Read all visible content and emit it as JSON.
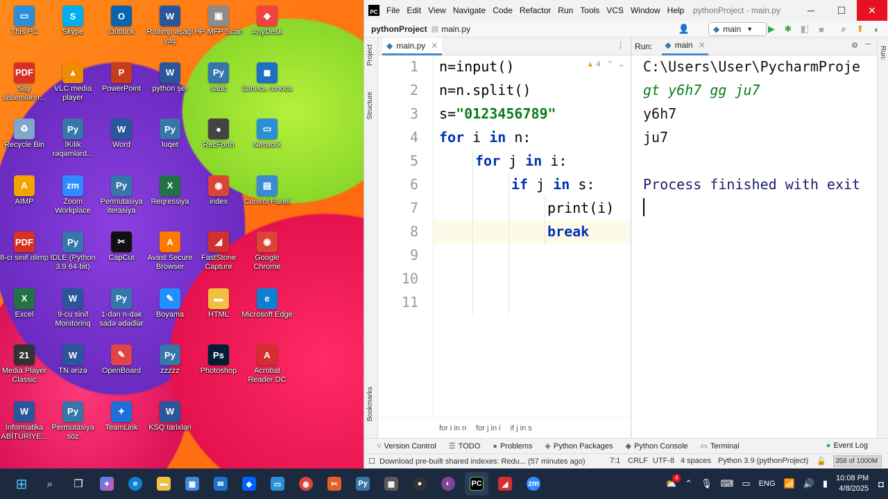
{
  "desktop": {
    "icons": [
      {
        "label": "This PC",
        "glyph": "▭",
        "color": "#2b8fd6"
      },
      {
        "label": "Skype",
        "glyph": "S",
        "color": "#00aff0"
      },
      {
        "label": "Outlook",
        "glyph": "O",
        "color": "#0a64ad"
      },
      {
        "label": "R olimp aşağı yaş",
        "glyph": "W",
        "color": "#2b579a"
      },
      {
        "label": "HP MFP Scan",
        "glyph": "▣",
        "color": "#8c8c8c"
      },
      {
        "label": "AnyDesk",
        "glyph": "◆",
        "color": "#ef443b"
      },
      {
        "label": "Say sistemlərin...",
        "glyph": "PDF",
        "color": "#d93025"
      },
      {
        "label": "VLC media player",
        "glyph": "▲",
        "color": "#f08a00"
      },
      {
        "label": "PowerPoint",
        "glyph": "P",
        "color": "#c43e1c"
      },
      {
        "label": "python şer",
        "glyph": "W",
        "color": "#2b579a"
      },
      {
        "label": "sabb",
        "glyph": "Py",
        "color": "#3776ab"
      },
      {
        "label": "Запись голоса",
        "glyph": "◼",
        "color": "#1f6fc5"
      },
      {
        "label": "Recycle Bin",
        "glyph": "♻",
        "color": "#7fa7c9"
      },
      {
        "label": "İKilik rəqəmlərd...",
        "glyph": "Py",
        "color": "#3776ab"
      },
      {
        "label": "Word",
        "glyph": "W",
        "color": "#2b579a"
      },
      {
        "label": "luqet",
        "glyph": "Py",
        "color": "#3776ab"
      },
      {
        "label": "RecForth",
        "glyph": "●",
        "color": "#444444"
      },
      {
        "label": "Network",
        "glyph": "▭",
        "color": "#2b8fd6"
      },
      {
        "label": "AIMP",
        "glyph": "A",
        "color": "#f5a300"
      },
      {
        "label": "Zoom Workplace",
        "glyph": "zm",
        "color": "#2d8cff"
      },
      {
        "label": "Permutasiya iterasiya",
        "glyph": "Py",
        "color": "#3776ab"
      },
      {
        "label": "Reqressiya",
        "glyph": "X",
        "color": "#217346"
      },
      {
        "label": "index",
        "glyph": "◉",
        "color": "#db4437"
      },
      {
        "label": "Control Panel",
        "glyph": "▤",
        "color": "#3a8ad6"
      },
      {
        "label": "8-ci sinif olimp",
        "glyph": "PDF",
        "color": "#d93025"
      },
      {
        "label": "IDLE (Python 3.9 64-bit)",
        "glyph": "Py",
        "color": "#3776ab"
      },
      {
        "label": "CapCut",
        "glyph": "✂",
        "color": "#111111"
      },
      {
        "label": "Avast Secure Browser",
        "glyph": "A",
        "color": "#ff7800"
      },
      {
        "label": "FastStone Capture",
        "glyph": "◢",
        "color": "#d42f2f"
      },
      {
        "label": "Google Chrome",
        "glyph": "◉",
        "color": "#db4437"
      },
      {
        "label": "Excel",
        "glyph": "X",
        "color": "#217346"
      },
      {
        "label": "9-cu sinif Monitorinq",
        "glyph": "W",
        "color": "#2b579a"
      },
      {
        "label": "1-dən n-dək sadə ədədlər",
        "glyph": "Py",
        "color": "#3776ab"
      },
      {
        "label": "Boyama",
        "glyph": "✎",
        "color": "#1e90ff"
      },
      {
        "label": "HTML",
        "glyph": "▬",
        "color": "#f0c040"
      },
      {
        "label": "Microsoft Edge",
        "glyph": "e",
        "color": "#0f7fd4"
      },
      {
        "label": "Media Player Classic",
        "glyph": "21",
        "color": "#333333"
      },
      {
        "label": "TN ərizə",
        "glyph": "W",
        "color": "#2b579a"
      },
      {
        "label": "OpenBoard",
        "glyph": "✎",
        "color": "#e04444"
      },
      {
        "label": "zzzzz",
        "glyph": "Py",
        "color": "#3776ab"
      },
      {
        "label": "Photoshop",
        "glyph": "Ps",
        "color": "#001e36"
      },
      {
        "label": "Acrobat Reader DC",
        "glyph": "A",
        "color": "#d42f2f"
      },
      {
        "label": "İnformatika ABİTURİYE...",
        "glyph": "W",
        "color": "#2b579a"
      },
      {
        "label": "Permutasiya söz",
        "glyph": "Py",
        "color": "#3776ab"
      },
      {
        "label": "TeamLink",
        "glyph": "✦",
        "color": "#1e6fd9"
      },
      {
        "label": "KSQ tarixləri",
        "glyph": "W",
        "color": "#2b579a"
      }
    ]
  },
  "ide": {
    "menu": [
      "File",
      "Edit",
      "View",
      "Navigate",
      "Code",
      "Refactor",
      "Run",
      "Tools",
      "VCS",
      "Window",
      "Help"
    ],
    "window_title": "pythonProject - main.py",
    "logo": "PC",
    "breadcrumb_project": "pythonProject",
    "breadcrumb_file": "main.py",
    "run_config": "main",
    "left_tabs": {
      "project": "Project",
      "structure": "Structure",
      "bookmarks": "Bookmarks"
    },
    "editor_tab": "main.py",
    "inspection_count": "4",
    "line_numbers": [
      "1",
      "2",
      "3",
      "4",
      "5",
      "6",
      "7",
      "8",
      "9",
      "10",
      "11"
    ],
    "code": {
      "l1": "n=input()",
      "l2": "n=n.split()",
      "l3_a": "s=",
      "l3_b": "\"0123456789\"",
      "l4_kw1": "for",
      "l4_a": " i ",
      "l4_kw2": "in",
      "l4_b": " n:",
      "l5_kw1": "for",
      "l5_a": " j ",
      "l5_kw2": "in",
      "l5_b": " i:",
      "l6_kw1": "if",
      "l6_a": " j ",
      "l6_kw2": "in",
      "l6_b": " s:",
      "l7": "print(i)",
      "l8": "break"
    },
    "breadcrumbs": [
      "for i in n",
      "for j in i",
      "if j in s"
    ],
    "run_label": "Run:",
    "run_tab": "main",
    "console": {
      "path": "C:\\Users\\User\\PycharmProje",
      "input": "gt y6h7 gg ju7",
      "out1": "y6h7",
      "out2": "ju7",
      "finished": "Process finished with exit"
    },
    "tool_windows": [
      "Version Control",
      "TODO",
      "Problems",
      "Python Packages",
      "Python Console",
      "Terminal"
    ],
    "event_log": "Event Log",
    "status": {
      "message": "Download pre-built shared indexes: Redu... (57 minutes ago)",
      "position": "7:1",
      "line_sep": "CRLF",
      "encoding": "UTF-8",
      "indent": "4 spaces",
      "interpreter": "Python 3.9 (pythonProject)",
      "memory": "358 of 1000M"
    }
  },
  "taskbar": {
    "language": "ENG",
    "time": "10:08 PM",
    "date": "4/8/2025",
    "notification_badge": "4"
  }
}
